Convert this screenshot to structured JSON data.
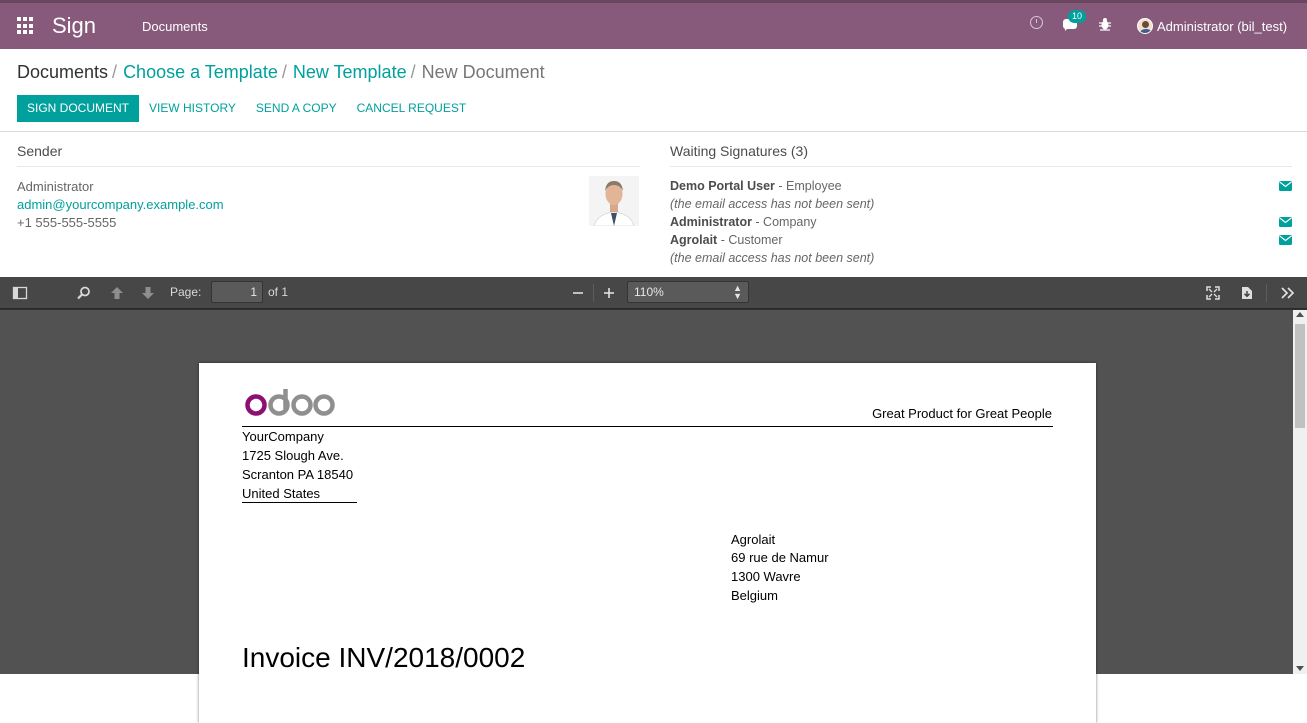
{
  "navbar": {
    "app_title": "Sign",
    "menu_documents": "Documents",
    "chat_badge": "10",
    "user_name": "Administrator (bil_test)"
  },
  "breadcrumb": {
    "items": [
      "Documents",
      "Choose a Template",
      "New Template"
    ],
    "active": "New Document",
    "separator": "/"
  },
  "actions": {
    "sign_document": "SIGN DOCUMENT",
    "view_history": "VIEW HISTORY",
    "send_copy": "SEND A COPY",
    "cancel_request": "CANCEL REQUEST"
  },
  "sender": {
    "title": "Sender",
    "name": "Administrator",
    "email": "admin@yourcompany.example.com",
    "phone": "+1 555-555-5555"
  },
  "waiting": {
    "title": "Waiting Signatures (3)",
    "signers": [
      {
        "name": "Demo Portal User",
        "role": " - Employee",
        "note": "(the email access has not been sent)"
      },
      {
        "name": "Administrator",
        "role": " - Company",
        "note": ""
      },
      {
        "name": "Agrolait",
        "role": " - Customer",
        "note": "(the email access has not been sent)"
      }
    ]
  },
  "viewer": {
    "page_label": "Page:",
    "page_value": "1",
    "page_total": "of 1",
    "zoom": "110%"
  },
  "document": {
    "logo_text": "odoo",
    "tagline": "Great Product for Great People",
    "company_address": [
      "YourCompany",
      "1725 Slough Ave.",
      "Scranton PA 18540",
      "United States"
    ],
    "customer_address": [
      "Agrolait",
      "69 rue de Namur",
      "1300 Wavre",
      "Belgium"
    ],
    "title": "Invoice INV/2018/0002"
  },
  "colors": {
    "brand": "#875a7b",
    "accent": "#00a09d"
  }
}
